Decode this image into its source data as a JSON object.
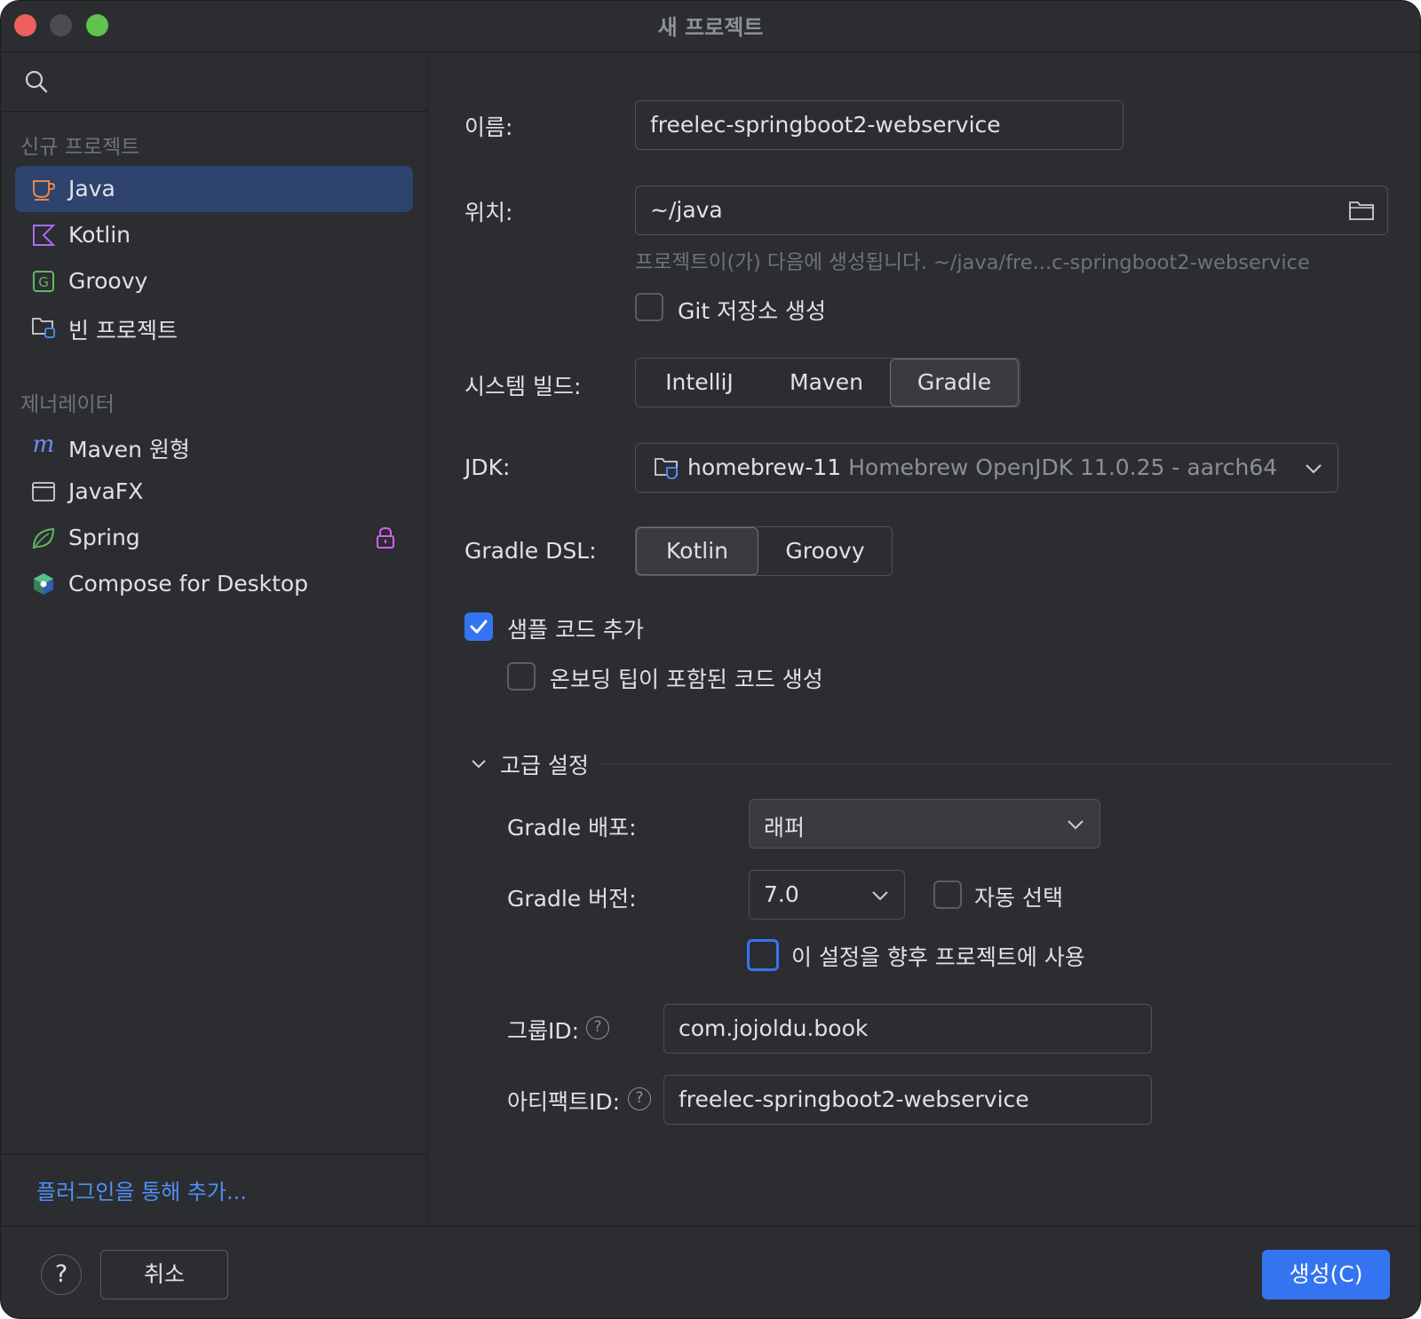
{
  "window": {
    "title": "새 프로젝트"
  },
  "sidebar": {
    "sections": [
      {
        "heading": "신규 프로젝트",
        "items": [
          {
            "label": "Java",
            "icon": "java-cup-icon",
            "selected": true
          },
          {
            "label": "Kotlin",
            "icon": "kotlin-icon"
          },
          {
            "label": "Groovy",
            "icon": "groovy-icon"
          },
          {
            "label": "빈 프로젝트",
            "icon": "empty-project-icon"
          }
        ]
      },
      {
        "heading": "제너레이터",
        "items": [
          {
            "label": "Maven 원형",
            "icon": "maven-icon"
          },
          {
            "label": "JavaFX",
            "icon": "javafx-window-icon"
          },
          {
            "label": "Spring",
            "icon": "spring-leaf-icon",
            "locked": true
          },
          {
            "label": "Compose for Desktop",
            "icon": "compose-icon"
          }
        ]
      }
    ],
    "plugin_link": "플러그인을 통해 추가..."
  },
  "form": {
    "name": {
      "label": "이름:",
      "value": "freelec-springboot2-webservice"
    },
    "location": {
      "label": "위치:",
      "value": "~/java",
      "hint": "프로젝트이(가) 다음에 생성됩니다. ~/java/fre...c-springboot2-webservice"
    },
    "git": {
      "label": "Git 저장소 생성",
      "checked": false
    },
    "build_system": {
      "label": "시스템 빌드:",
      "options": [
        "IntelliJ",
        "Maven",
        "Gradle"
      ],
      "selected": "Gradle"
    },
    "jdk": {
      "label": "JDK:",
      "name": "homebrew-11",
      "detail": "Homebrew OpenJDK 11.0.25 - aarch64"
    },
    "gradle_dsl": {
      "label": "Gradle DSL:",
      "options": [
        "Kotlin",
        "Groovy"
      ],
      "selected": "Kotlin"
    },
    "sample_code": {
      "label": "샘플 코드 추가",
      "checked": true
    },
    "onboarding": {
      "label": "온보딩 팁이 포함된 코드 생성",
      "checked": false
    },
    "advanced": {
      "title": "고급 설정",
      "expanded": true,
      "distribution": {
        "label": "Gradle 배포:",
        "value": "래퍼"
      },
      "version": {
        "label": "Gradle 버전:",
        "value": "7.0"
      },
      "auto_select": {
        "label": "자동 선택",
        "checked": false
      },
      "use_future": {
        "label": "이 설정을 향후 프로젝트에 사용",
        "checked": false
      },
      "group_id": {
        "label": "그룹ID:",
        "value": "com.jojoldu.book"
      },
      "artifact_id": {
        "label": "아티팩트ID:",
        "value": "freelec-springboot2-webservice"
      },
      "help_glyph": "?"
    }
  },
  "footer": {
    "help": "?",
    "cancel": "취소",
    "create": "생성(C)"
  },
  "colors": {
    "accent": "#3574f0",
    "link": "#4f8ff7",
    "selection": "#2e436e",
    "background": "#2b2d30"
  }
}
